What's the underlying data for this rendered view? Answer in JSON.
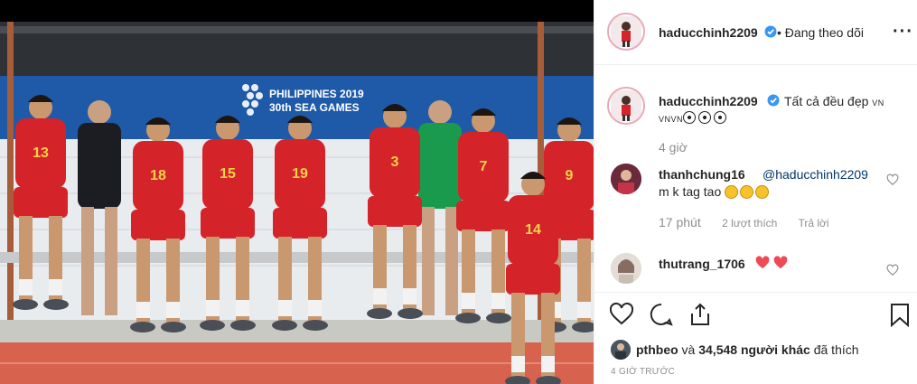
{
  "post": {
    "username": "haducchinh2209",
    "follow_status": "• Đang theo dõi",
    "more_icon": "more-horizontal-icon"
  },
  "photo": {
    "banner_line1": "PHILIPPINES 2019",
    "banner_line2": "30th SEA GAMES",
    "jerseys": [
      "13",
      "18",
      "15",
      "19",
      "3",
      "7",
      "9",
      "14"
    ]
  },
  "caption": {
    "username": "haducchinh2209",
    "text": "Tất cả đều đẹp",
    "flag_vn": "VN",
    "line2_prefix": "VNVN",
    "time": "4 giờ"
  },
  "comments": [
    {
      "username": "thanhchung16",
      "mention": "@haducchinh2209",
      "text": "m k tag tao",
      "time": "17 phút",
      "likes": "2 lượt thích",
      "reply": "Trả lời"
    },
    {
      "username": "thutrang_1706"
    }
  ],
  "likes": {
    "user": "pthbeo",
    "middle": " và ",
    "count": "34,548 người khác",
    "suffix": " đã thích"
  },
  "timestamp": "4 GIỜ TRƯỚC",
  "colors": {
    "jersey_red": "#d4242a",
    "banner_blue": "#1f5aa8",
    "verified_blue": "#3897f0",
    "heart_red": "#ed4956",
    "link_blue": "#003569"
  }
}
